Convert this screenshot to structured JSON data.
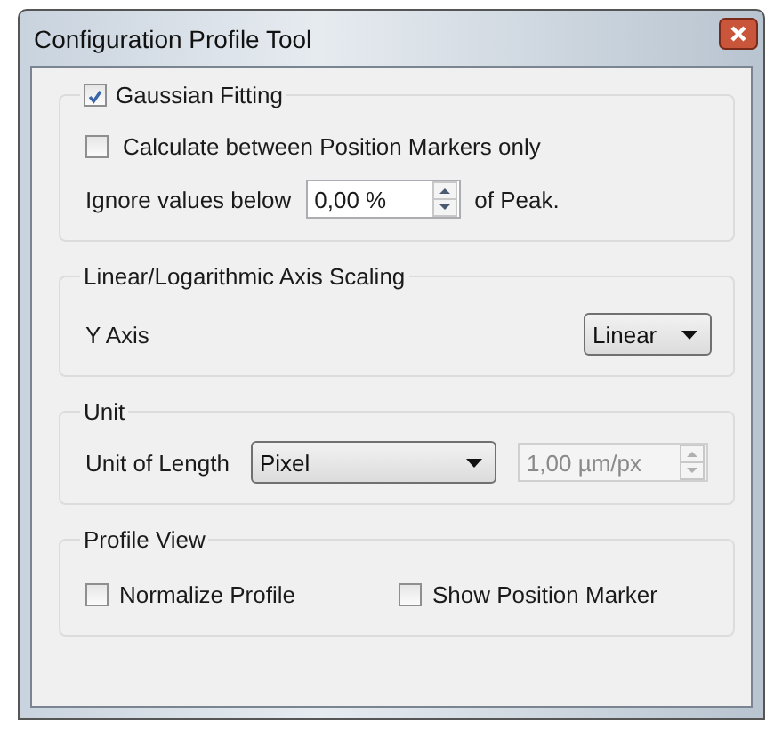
{
  "window": {
    "title": "Configuration Profile Tool"
  },
  "gaussian_fitting": {
    "label": "Gaussian Fitting",
    "checked": true,
    "between_markers": {
      "label": "Calculate between Position Markers only",
      "checked": false
    },
    "ignore_label": "Ignore values below",
    "threshold": {
      "value": "0,00 %"
    },
    "suffix": "of Peak."
  },
  "axis_scaling": {
    "title": "Linear/Logarithmic Axis Scaling",
    "y_axis_label": "Y Axis",
    "y_axis_value": "Linear"
  },
  "unit": {
    "title": "Unit",
    "label": "Unit of Length",
    "value": "Pixel",
    "scale": {
      "value": "1,00 µm/px",
      "disabled": true
    }
  },
  "profile_view": {
    "title": "Profile View",
    "options": [
      {
        "label": "Normalize Profile",
        "checked": false
      },
      {
        "label": "Show Position Marker",
        "checked": false
      }
    ]
  }
}
